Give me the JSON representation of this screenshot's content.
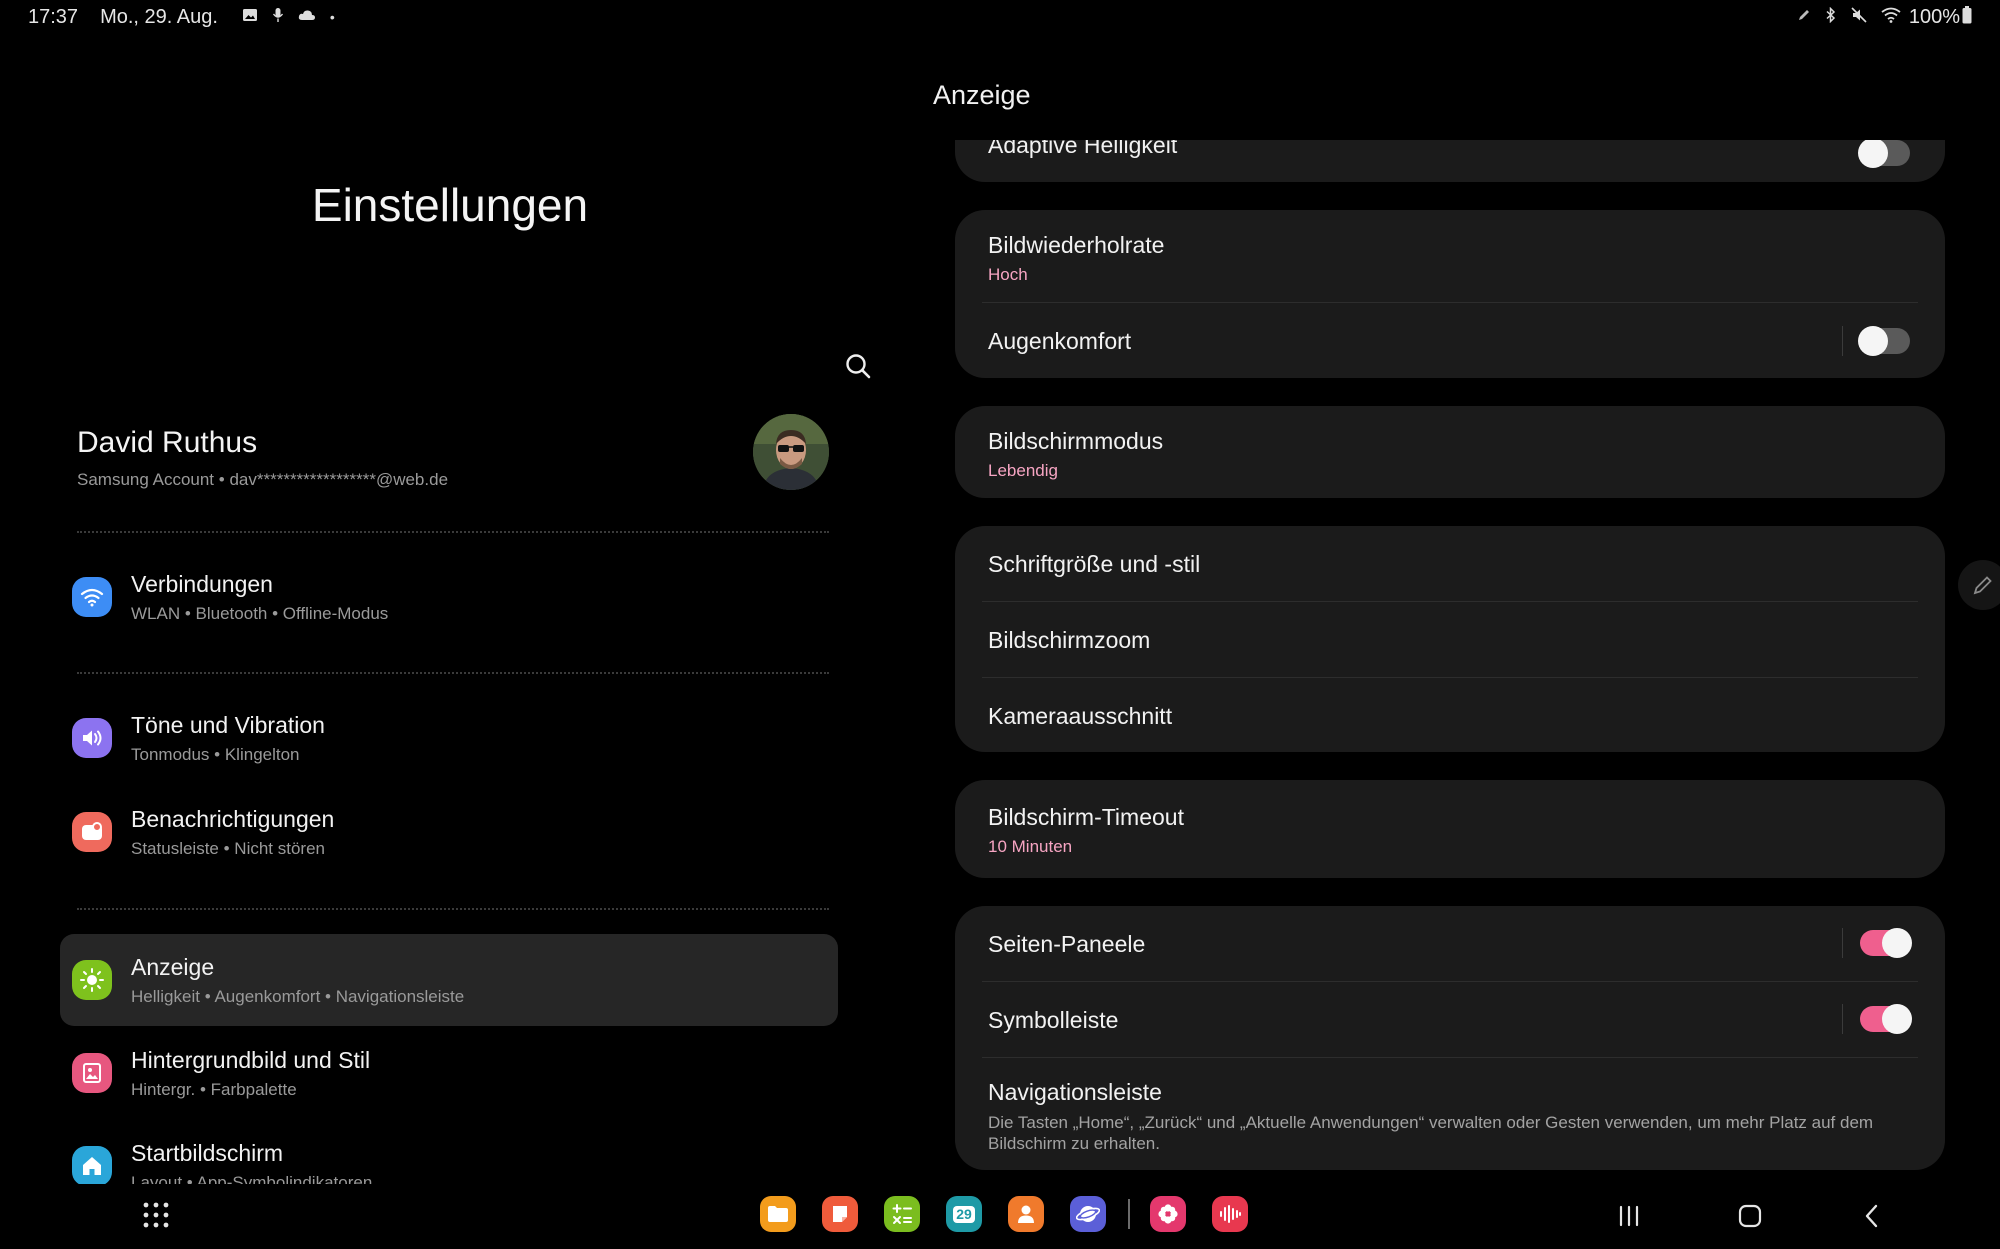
{
  "status_bar": {
    "time": "17:37",
    "date": "Mo., 29. Aug.",
    "battery": "100%"
  },
  "left_pane": {
    "title": "Einstellungen",
    "account": {
      "name": "David Ruthus",
      "type": "Samsung Account",
      "email": "dav******************@web.de"
    },
    "items": [
      {
        "title": "Verbindungen",
        "subs": [
          "WLAN",
          "Bluetooth",
          "Offline-Modus"
        ],
        "icon": "wifi-icon",
        "color": "#3d8df5"
      },
      {
        "title": "Töne und Vibration",
        "subs": [
          "Tonmodus",
          "Klingelton"
        ],
        "icon": "speaker-icon",
        "color": "#8c73f0"
      },
      {
        "title": "Benachrichtigungen",
        "subs": [
          "Statusleiste",
          "Nicht stören"
        ],
        "icon": "notification-icon",
        "color": "#ef6a5d"
      },
      {
        "title": "Anzeige",
        "subs": [
          "Helligkeit",
          "Augenkomfort",
          "Navigationsleiste"
        ],
        "icon": "sun-icon",
        "color": "#7ec21d"
      },
      {
        "title": "Hintergrundbild und Stil",
        "subs": [
          "Hintergr.",
          "Farbpalette"
        ],
        "icon": "wallpaper-icon",
        "color": "#e7577f"
      },
      {
        "title": "Startbildschirm",
        "subs": [
          "Layout",
          "App-Symbolindikatoren"
        ],
        "icon": "home-icon",
        "color": "#2aa6d9"
      }
    ]
  },
  "right_pane": {
    "title": "Anzeige",
    "adaptive_brightness": "Adaptive Helligkeit",
    "refresh_rate": {
      "title": "Bildwiederholrate",
      "value": "Hoch"
    },
    "eye_comfort": {
      "title": "Augenkomfort",
      "enabled": false
    },
    "screen_mode": {
      "title": "Bildschirmmodus",
      "value": "Lebendig"
    },
    "font_size": "Schriftgröße und -stil",
    "screen_zoom": "Bildschirmzoom",
    "camera_cutout": "Kameraausschnitt",
    "screen_timeout": {
      "title": "Bildschirm-Timeout",
      "value": "10 Minuten"
    },
    "side_panels": {
      "title": "Seiten-Paneele",
      "enabled": true
    },
    "toolbar": {
      "title": "Symbolleiste",
      "enabled": true
    },
    "navigation_bar": {
      "title": "Navigationsleiste",
      "description": "Die Tasten „Home“, „Zurück“ und „Aktuelle Anwendungen“ verwalten oder Gesten verwenden, um mehr Platz auf dem Bildschirm zu erhalten."
    }
  },
  "dock": {
    "calendar_day": "29",
    "apps": [
      {
        "name": "files-app-icon",
        "color": "#f39c1c"
      },
      {
        "name": "notes-app-icon",
        "color": "#ef5b3b"
      },
      {
        "name": "calculator-app-icon",
        "color": "#7bbd1f"
      },
      {
        "name": "calendar-app-icon",
        "color": "#1e9aa6"
      },
      {
        "name": "contacts-app-icon",
        "color": "#f07a2c"
      },
      {
        "name": "internet-app-icon",
        "color": "#5b5fd8"
      },
      {
        "name": "gallery-app-icon",
        "color": "#e4386d"
      },
      {
        "name": "voice-recorder-app-icon",
        "color": "#e8384f"
      }
    ]
  },
  "colors": {
    "accent": "#ef5f8e",
    "subtitle_accent": "#f7a5c3",
    "card_bg": "#1b1b1b",
    "active_item_bg": "#262626"
  }
}
